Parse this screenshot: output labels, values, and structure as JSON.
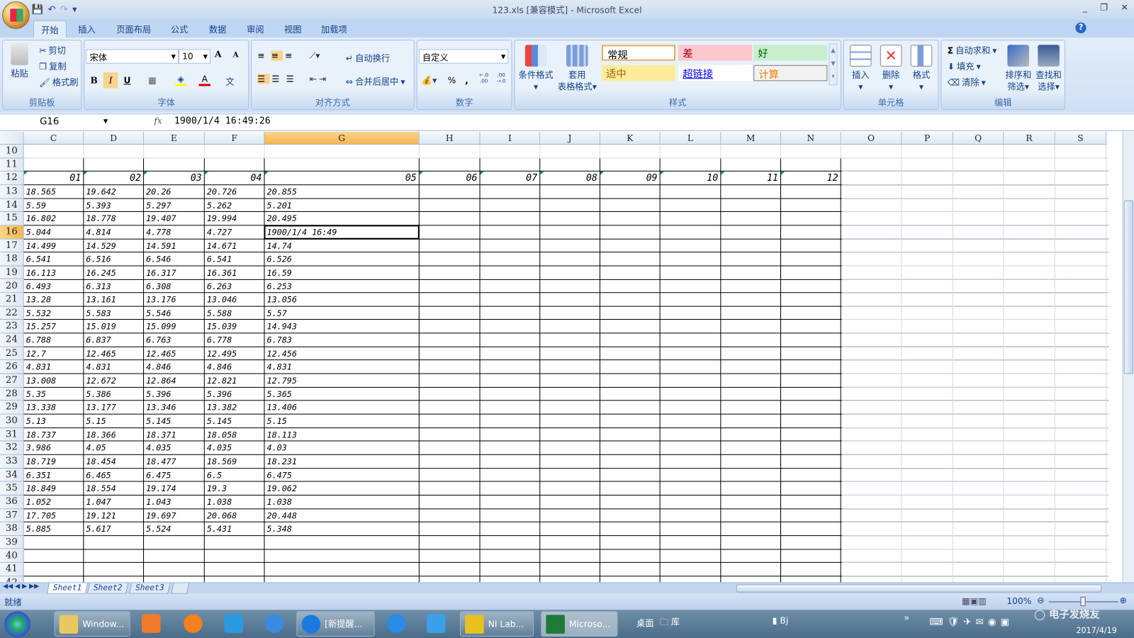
{
  "window": {
    "title": "123.xls  [兼容模式] - Microsoft Excel",
    "min": "_",
    "restore": "❐",
    "close": "✕"
  },
  "qat": {
    "save": "💾",
    "undo": "↶",
    "redo": "↷",
    "more": "▾"
  },
  "tabs": [
    "开始",
    "插入",
    "页面布局",
    "公式",
    "数据",
    "审阅",
    "视图",
    "加载项"
  ],
  "active_tab": 0,
  "help": "?",
  "clipboard": {
    "paste": "粘贴",
    "cut": "剪切",
    "copy": "复制",
    "format_painter": "格式刷",
    "label": "剪贴板"
  },
  "font": {
    "name": "宋体",
    "size": "10",
    "grow": "A",
    "shrink": "A",
    "bold": "B",
    "italic": "I",
    "underline": "U",
    "phonetic": "文",
    "label": "字体",
    "fill_color": "#ffff00",
    "font_color": "#e00000"
  },
  "alignment": {
    "wrap": "自动换行",
    "merge": "合并后居中",
    "label": "对齐方式"
  },
  "number": {
    "format": "自定义",
    "percent": "%",
    "comma": ",",
    "inc_decimal": "←.0 .00",
    "dec_decimal": ".00 →.0",
    "label": "数字"
  },
  "styles": {
    "conditional": "条件格式",
    "table_format_1": "套用",
    "table_format_2": "表格格式",
    "label": "样式",
    "cells": [
      {
        "text": "常规",
        "bg": "#ffffff",
        "fg": "#000000"
      },
      {
        "text": "差",
        "bg": "#ffc7ce",
        "fg": "#9c0006"
      },
      {
        "text": "好",
        "bg": "#c6efce",
        "fg": "#006100"
      },
      {
        "text": "适中",
        "bg": "#ffeb9c",
        "fg": "#9c6500"
      },
      {
        "text": "超链接",
        "bg": "#ffffff",
        "fg": "#0000ff"
      },
      {
        "text": "计算",
        "bg": "#f2f2f2",
        "fg": "#fa7d00"
      }
    ]
  },
  "cells_group": {
    "insert": "插入",
    "delete": "删除",
    "format": "格式",
    "label": "单元格"
  },
  "editing": {
    "autosum": "自动求和",
    "fill": "填充",
    "clear": "清除",
    "sort_1": "排序和",
    "sort_2": "筛选",
    "find_1": "查找和",
    "find_2": "选择",
    "label": "编辑"
  },
  "formula_bar": {
    "name_box": "G16",
    "fx": "fx",
    "value": "1900/1/4  16:49:26"
  },
  "sheet": {
    "columns": [
      "C",
      "D",
      "E",
      "F",
      "G",
      "H",
      "I",
      "J",
      "K",
      "L",
      "M",
      "N",
      "O",
      "P",
      "Q",
      "R",
      "S"
    ],
    "selected_column": "G",
    "selected_row": 16,
    "row_numbers": [
      10,
      11,
      12,
      13,
      14,
      15,
      16,
      17,
      18,
      19,
      20,
      21,
      22,
      23,
      24,
      25,
      26,
      27,
      28,
      29,
      30,
      31,
      32,
      33,
      34,
      35,
      36,
      37,
      38,
      39,
      40,
      41,
      42
    ],
    "header_row": [
      "01",
      "02",
      "03",
      "04",
      "05",
      "06",
      "07",
      "08",
      "09",
      "10",
      "11",
      "12"
    ],
    "data": [
      [
        "18.565",
        "19.642",
        "20.26",
        "20.726",
        "20.855"
      ],
      [
        "5.59",
        "5.393",
        "5.297",
        "5.262",
        "5.201"
      ],
      [
        "16.802",
        "18.778",
        "19.407",
        "19.994",
        "20.495"
      ],
      [
        "5.044",
        "4.814",
        "4.778",
        "4.727",
        "1900/1/4 16:49"
      ],
      [
        "14.499",
        "14.529",
        "14.591",
        "14.671",
        "14.74"
      ],
      [
        "6.541",
        "6.516",
        "6.546",
        "6.541",
        "6.526"
      ],
      [
        "16.113",
        "16.245",
        "16.317",
        "16.361",
        "16.59"
      ],
      [
        "6.493",
        "6.313",
        "6.308",
        "6.263",
        "6.253"
      ],
      [
        "13.28",
        "13.161",
        "13.176",
        "13.046",
        "13.056"
      ],
      [
        "5.532",
        "5.583",
        "5.546",
        "5.588",
        "5.57"
      ],
      [
        "15.257",
        "15.019",
        "15.099",
        "15.039",
        "14.943"
      ],
      [
        "6.788",
        "6.837",
        "6.763",
        "6.778",
        "6.783"
      ],
      [
        "12.7",
        "12.465",
        "12.465",
        "12.495",
        "12.456"
      ],
      [
        "4.831",
        "4.831",
        "4.846",
        "4.846",
        "4.831"
      ],
      [
        "13.008",
        "12.672",
        "12.864",
        "12.821",
        "12.795"
      ],
      [
        "5.35",
        "5.386",
        "5.396",
        "5.396",
        "5.365"
      ],
      [
        "13.338",
        "13.177",
        "13.346",
        "13.382",
        "13.406"
      ],
      [
        "5.13",
        "5.15",
        "5.145",
        "5.145",
        "5.15"
      ],
      [
        "18.737",
        "18.366",
        "18.371",
        "18.058",
        "18.113"
      ],
      [
        "3.986",
        "4.05",
        "4.035",
        "4.035",
        "4.03"
      ],
      [
        "18.719",
        "18.454",
        "18.477",
        "18.569",
        "18.231"
      ],
      [
        "6.351",
        "6.465",
        "6.475",
        "6.5",
        "6.475"
      ],
      [
        "18.849",
        "18.554",
        "19.174",
        "19.3",
        "19.062"
      ],
      [
        "1.052",
        "1.047",
        "1.043",
        "1.038",
        "1.038"
      ],
      [
        "17.705",
        "19.121",
        "19.697",
        "20.068",
        "20.448"
      ],
      [
        "5.885",
        "5.617",
        "5.524",
        "5.431",
        "5.348"
      ]
    ]
  },
  "sheet_tabs": [
    "Sheet1",
    "Sheet2",
    "Sheet3"
  ],
  "active_sheet": 0,
  "status": {
    "ready": "就绪",
    "zoom": "100%"
  },
  "taskbar": {
    "items": [
      "Window...",
      "[新提醒...",
      "NI Lab...",
      "Microso..."
    ],
    "desktop": "桌面",
    "library": "库",
    "bj": "Bj",
    "date": "2017/4/19",
    "watermark": "电子发烧友 www.elecfans.com"
  }
}
